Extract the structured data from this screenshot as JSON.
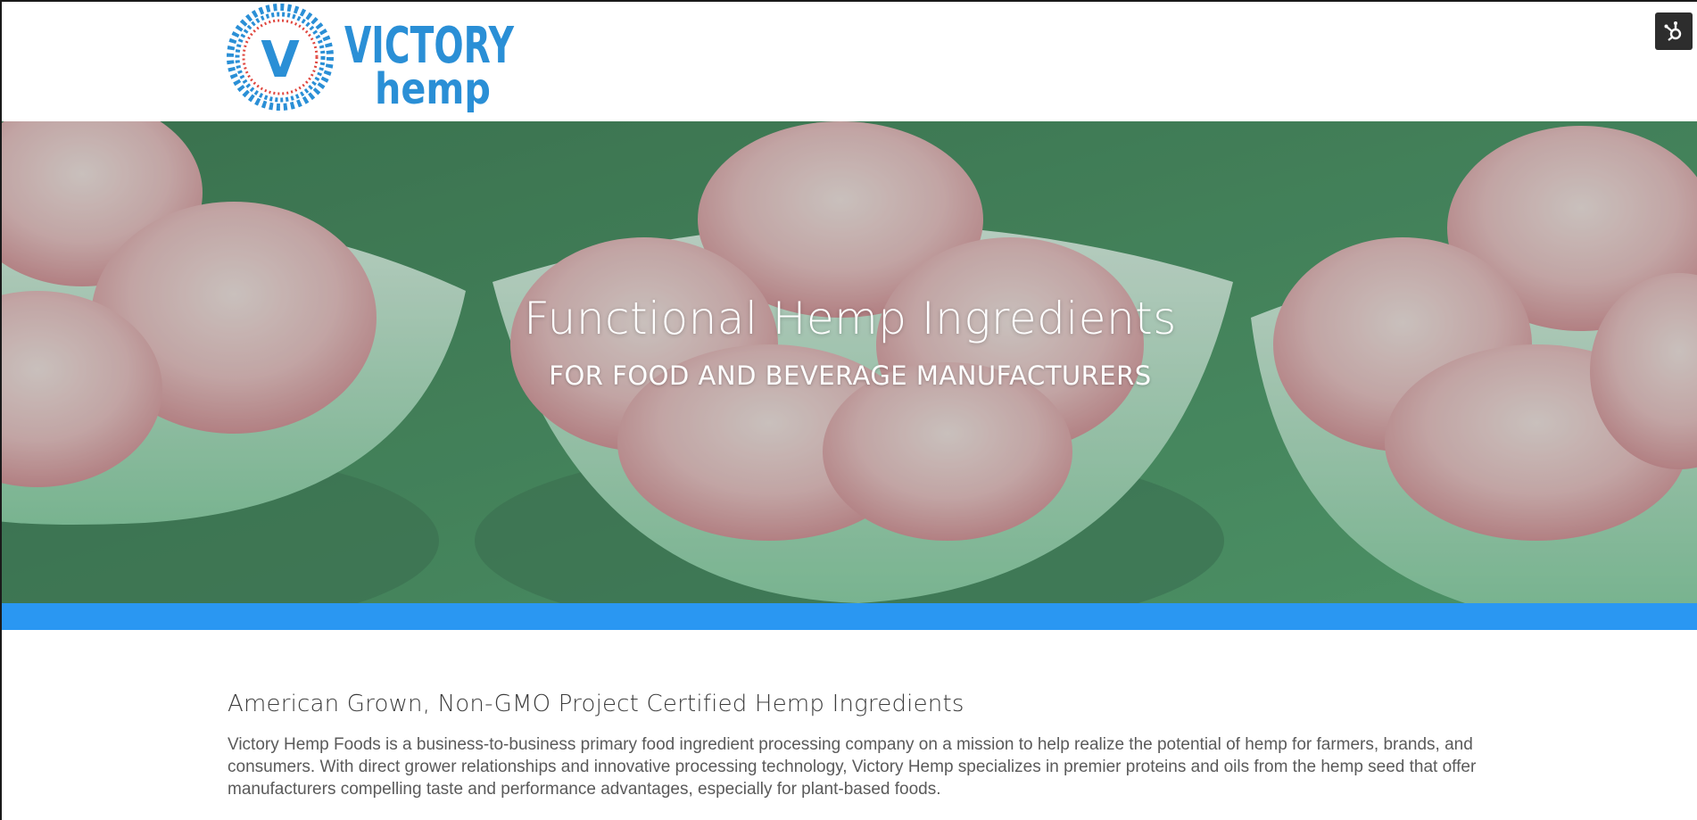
{
  "header": {
    "logo": {
      "brand_top": "VICTORY",
      "brand_bottom": "hemp",
      "monogram": "V"
    },
    "hubspot_icon": "hubspot-sprocket-icon"
  },
  "hero": {
    "title": "Functional Hemp Ingredients",
    "subtitle": "FOR FOOD AND BEVERAGE MANUFACTURERS",
    "background_color": "#4e8a63"
  },
  "accent_bar_color": "#2a97f2",
  "intro": {
    "heading": "American Grown, Non-GMO Project Certified Hemp Ingredients",
    "body": "Victory Hemp Foods is a business-to-business primary food ingredient processing company on a mission to help realize the potential of hemp for farmers, brands, and consumers. With direct grower relationships and innovative processing technology, Victory Hemp specializes in premier proteins and oils from the hemp seed that offer manufacturers compelling taste and performance advantages, especially for plant-based foods."
  },
  "colors": {
    "brand_blue": "#2a97f2",
    "logo_red": "#e0473f",
    "logo_blue": "#2a8fd6"
  }
}
